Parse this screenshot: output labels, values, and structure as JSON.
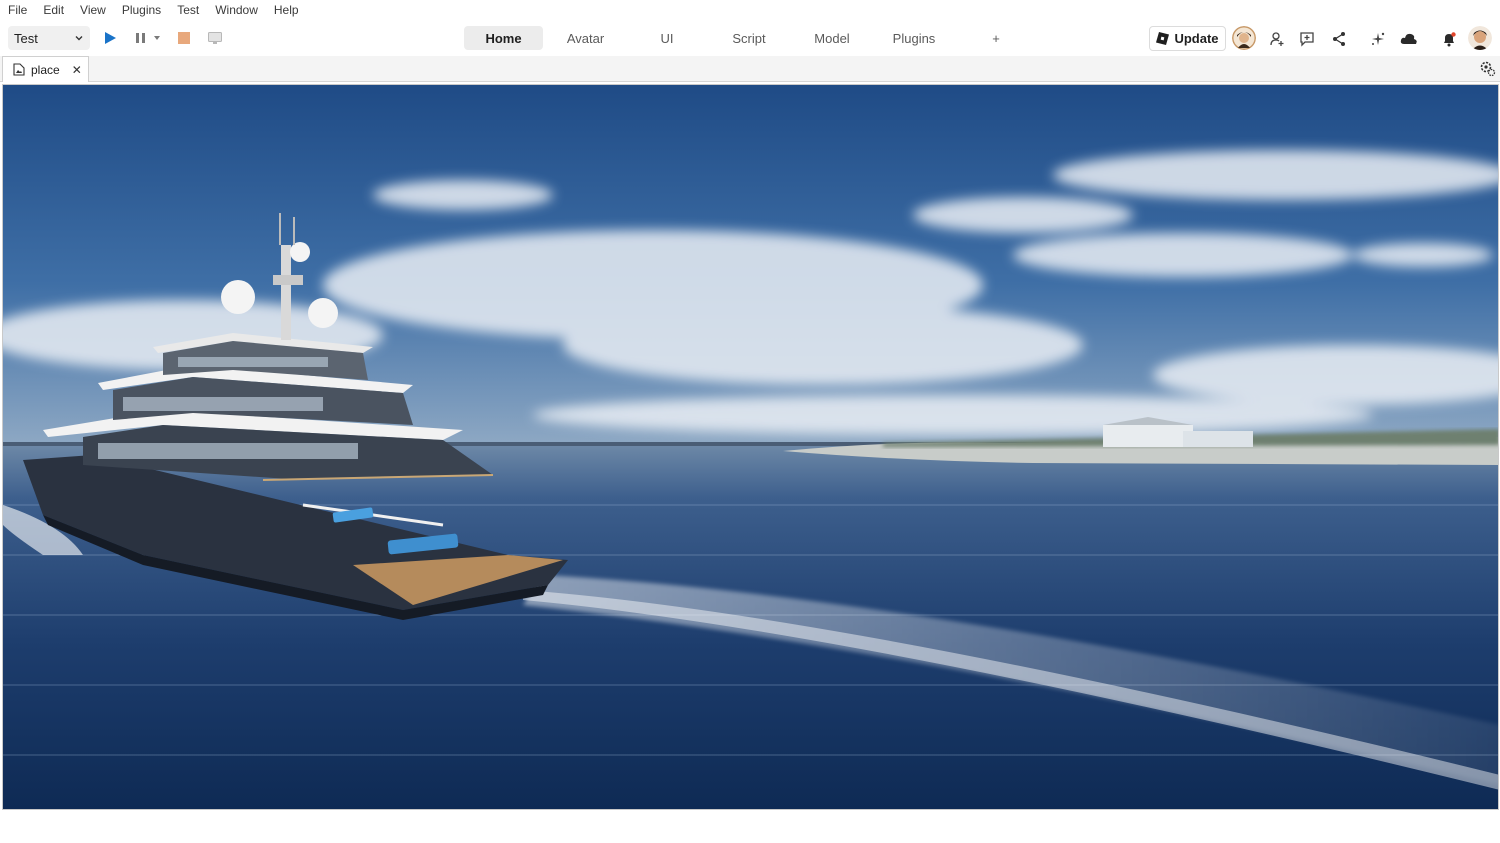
{
  "menu": [
    "File",
    "Edit",
    "View",
    "Plugins",
    "Test",
    "Window",
    "Help"
  ],
  "toolbar": {
    "mode_value": "Test",
    "play_icon": "play-icon",
    "pause_icon": "pause-icon",
    "stop_icon": "stop-icon",
    "tabs": [
      {
        "label": "Home",
        "active": true
      },
      {
        "label": "Avatar",
        "active": false
      },
      {
        "label": "UI",
        "active": false
      },
      {
        "label": "Script",
        "active": false
      },
      {
        "label": "Model",
        "active": false
      },
      {
        "label": "Plugins",
        "active": false
      },
      {
        "label": "+",
        "active": false
      }
    ],
    "update_label": "Update"
  },
  "document": {
    "tab_label": "place",
    "close_glyph": "✕"
  },
  "colors": {
    "accent_play": "#1a73c8",
    "stop": "#e8a87c",
    "sky_top": "#1f4b86",
    "sea_dark": "#0e2a54"
  }
}
